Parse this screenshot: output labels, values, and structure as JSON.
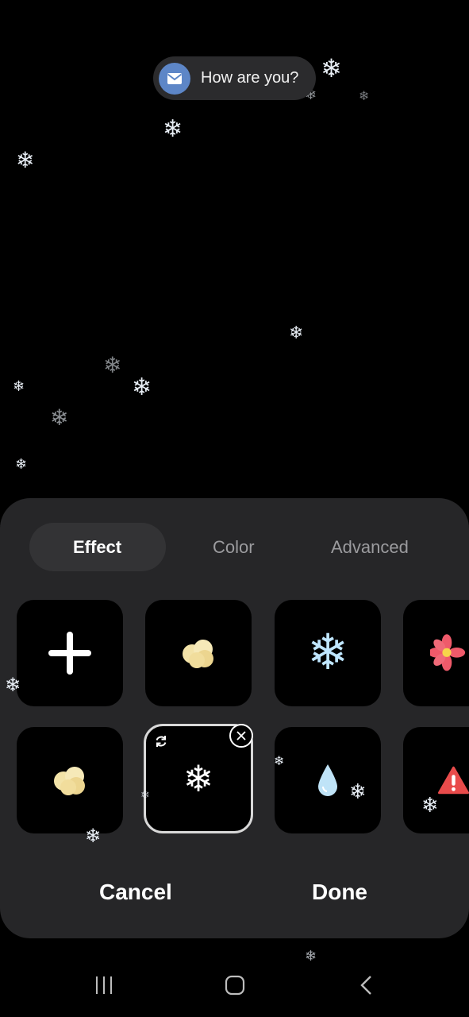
{
  "toast": {
    "icon": "mail-icon",
    "text": "How are you?"
  },
  "tabs": [
    {
      "label": "Effect",
      "active": true
    },
    {
      "label": "Color",
      "active": false
    },
    {
      "label": "Advanced",
      "active": false
    }
  ],
  "effects": [
    {
      "name": "add-effect-tile",
      "icon": "plus-icon"
    },
    {
      "name": "popcorn-effect-tile",
      "icon": "popcorn-icon"
    },
    {
      "name": "snowflake-blue-effect-tile",
      "icon": "snowflake-icon"
    },
    {
      "name": "flower-effect-tile",
      "icon": "flower-icon"
    },
    {
      "name": "popcorn-effect-tile-2",
      "icon": "popcorn-icon"
    },
    {
      "name": "snowflake-effect-tile-selected",
      "icon": "snowflake-icon",
      "selected": true
    },
    {
      "name": "water-drop-effect-tile",
      "icon": "water-drop-icon"
    },
    {
      "name": "exclamation-effect-tile",
      "icon": "exclamation-icon"
    }
  ],
  "actions": {
    "cancel": "Cancel",
    "done": "Done"
  },
  "nav": {
    "recents": "recents-icon",
    "home": "home-icon",
    "back": "back-icon"
  },
  "colors": {
    "sheet": "#262628",
    "mail": "#5d86c7",
    "flower": "#ef5a6a",
    "alert": "#e94b4b"
  }
}
